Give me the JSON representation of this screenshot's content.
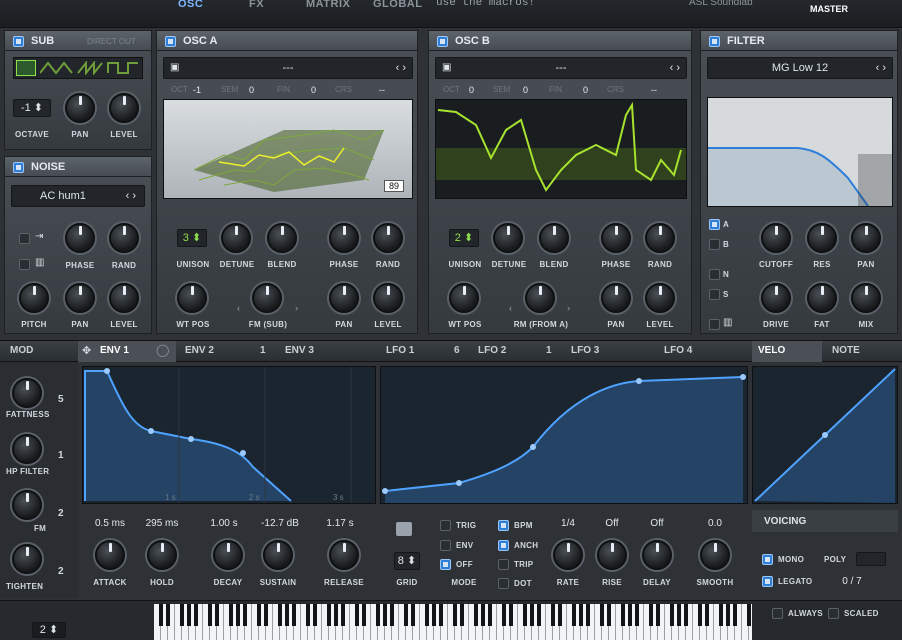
{
  "topbar": {
    "tabs": [
      "OSC",
      "FX",
      "MATRIX",
      "GLOBAL"
    ],
    "macro_hint": "use the macros!",
    "preset_author": "ASL Soundlab",
    "master_label": "MASTER"
  },
  "sub": {
    "title": "SUB",
    "direct_out": "DIRECT OUT",
    "octave_value": "-1",
    "labels": [
      "OCTAVE",
      "PAN",
      "LEVEL"
    ]
  },
  "noise": {
    "title": "NOISE",
    "preset": "AC hum1",
    "labels": [
      "PHASE",
      "RAND",
      "PITCH",
      "PAN",
      "LEVEL"
    ]
  },
  "osc_a": {
    "title": "OSC A",
    "wavetable": "---",
    "params": [
      {
        "name": "OCT",
        "value": "-1"
      },
      {
        "name": "SEM",
        "value": "0"
      },
      {
        "name": "FIN",
        "value": "0"
      },
      {
        "name": "CRS",
        "value": "--"
      }
    ],
    "frame": "89",
    "unison": "3",
    "labels_row1": [
      "UNISON",
      "DETUNE",
      "BLEND",
      "PHASE",
      "RAND"
    ],
    "labels_row2": [
      "WT POS",
      "FM (SUB)",
      "PAN",
      "LEVEL"
    ]
  },
  "osc_b": {
    "title": "OSC B",
    "wavetable": "---",
    "params": [
      {
        "name": "OCT",
        "value": "0"
      },
      {
        "name": "SEM",
        "value": "0"
      },
      {
        "name": "FIN",
        "value": "0"
      },
      {
        "name": "CRS",
        "value": "--"
      }
    ],
    "unison": "2",
    "labels_row1": [
      "UNISON",
      "DETUNE",
      "BLEND",
      "PHASE",
      "RAND"
    ],
    "labels_row2": [
      "WT POS",
      "RM (FROM A)",
      "PAN",
      "LEVEL"
    ]
  },
  "filter": {
    "title": "FILTER",
    "type": "MG Low 12",
    "routing": [
      "A",
      "B",
      "N",
      "S"
    ],
    "labels_row1": [
      "CUTOFF",
      "RES",
      "PAN"
    ],
    "labels_row2": [
      "DRIVE",
      "FAT",
      "MIX"
    ]
  },
  "mod_bar": {
    "mod_label": "MOD",
    "env_tabs": [
      "ENV 1",
      "ENV 2",
      "ENV 3"
    ],
    "env2_count": "1",
    "lfo_tabs": [
      "LFO 1",
      "LFO 2",
      "LFO 3",
      "LFO 4"
    ],
    "lfo1_count": "6",
    "lfo2_count": "1",
    "velo": "VELO",
    "note": "NOTE"
  },
  "macros": [
    {
      "label": "FATTNESS",
      "count": "5"
    },
    {
      "label": "HP FILTER",
      "count": "1"
    },
    {
      "label": "FM",
      "count": "2"
    },
    {
      "label": "TIGHTEN",
      "count": "2"
    }
  ],
  "env": {
    "grid_labels": [
      "1 s",
      "2 s",
      "3 s"
    ],
    "values": [
      "0.5 ms",
      "295 ms",
      "1.00 s",
      "-12.7 dB",
      "1.17 s"
    ],
    "labels": [
      "ATTACK",
      "HOLD",
      "DECAY",
      "SUSTAIN",
      "RELEASE"
    ]
  },
  "lfo": {
    "grid_value": "8",
    "grid_label": "GRID",
    "mode_label": "MODE",
    "modes": [
      "TRIG",
      "ENV",
      "OFF"
    ],
    "options": [
      "BPM",
      "ANCH",
      "TRIP",
      "DOT"
    ],
    "values": [
      "1/4",
      "Off",
      "Off",
      "0.0"
    ],
    "labels": [
      "RATE",
      "RISE",
      "DELAY",
      "SMOOTH"
    ]
  },
  "voicing": {
    "title": "VOICING",
    "mono": "MONO",
    "poly": "POLY",
    "legato": "LEGATO",
    "voices": "0 / 7"
  },
  "keyboard": {
    "octave": "2",
    "always": "ALWAYS",
    "scaled": "SCALED"
  },
  "colors": {
    "accent": "#2f7fd8",
    "wave_green": "#a6e22e",
    "curve_blue": "#4fa3ff"
  }
}
